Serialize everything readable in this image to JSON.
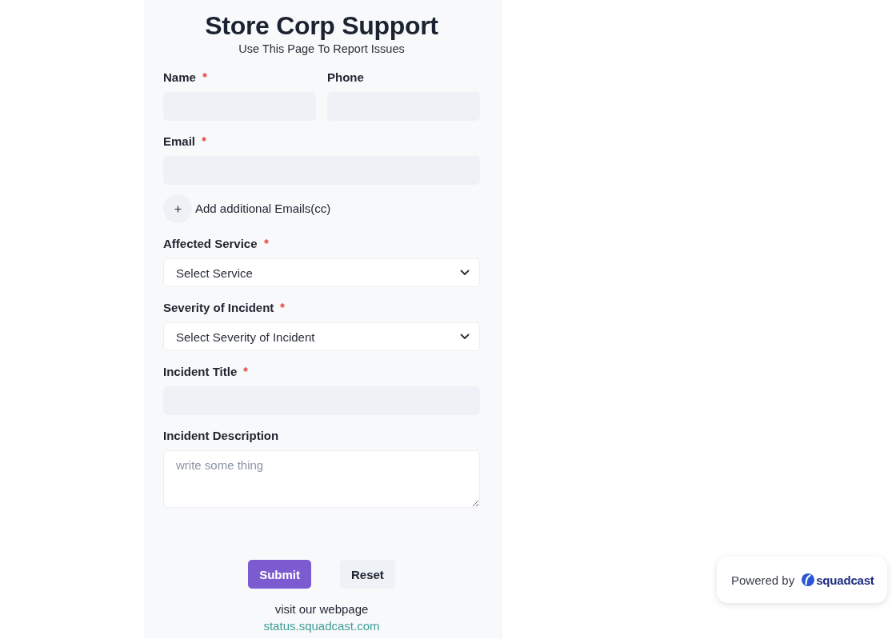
{
  "header": {
    "title": "Store Corp Support",
    "subtitle": "Use This Page To Report Issues"
  },
  "form": {
    "rows": [
      {
        "fields": [
          {
            "kind": "input",
            "label": "Name",
            "required": true
          },
          {
            "kind": "input",
            "label": "Phone",
            "required": false
          }
        ]
      },
      {
        "fields": [
          {
            "kind": "input",
            "label": "Email",
            "required": true
          }
        ]
      },
      {
        "fields": [
          {
            "kind": "add_cc",
            "label": "Add additional Emails(cc)"
          }
        ]
      },
      {
        "fields": [
          {
            "kind": "select",
            "label": "Affected Service",
            "required": true,
            "value": "Select Service"
          }
        ]
      },
      {
        "fields": [
          {
            "kind": "select",
            "label": "Severity of Incident",
            "required": true,
            "value": "Select Severity of Incident"
          }
        ]
      },
      {
        "fields": [
          {
            "kind": "input",
            "label": "Incident Title",
            "required": true
          }
        ]
      },
      {
        "fields": [
          {
            "kind": "textarea",
            "label": "Incident Description",
            "required": false,
            "placeholder": "write some thing"
          }
        ]
      }
    ],
    "buttons": [
      {
        "kind": "primary",
        "label": "Submit"
      },
      {
        "kind": "secondary",
        "label": "Reset"
      }
    ]
  },
  "footer": {
    "text": "visit our webpage",
    "link": "status.squadcast.com"
  },
  "powered_by": {
    "text": "Powered by",
    "brand": "squadcast"
  }
}
